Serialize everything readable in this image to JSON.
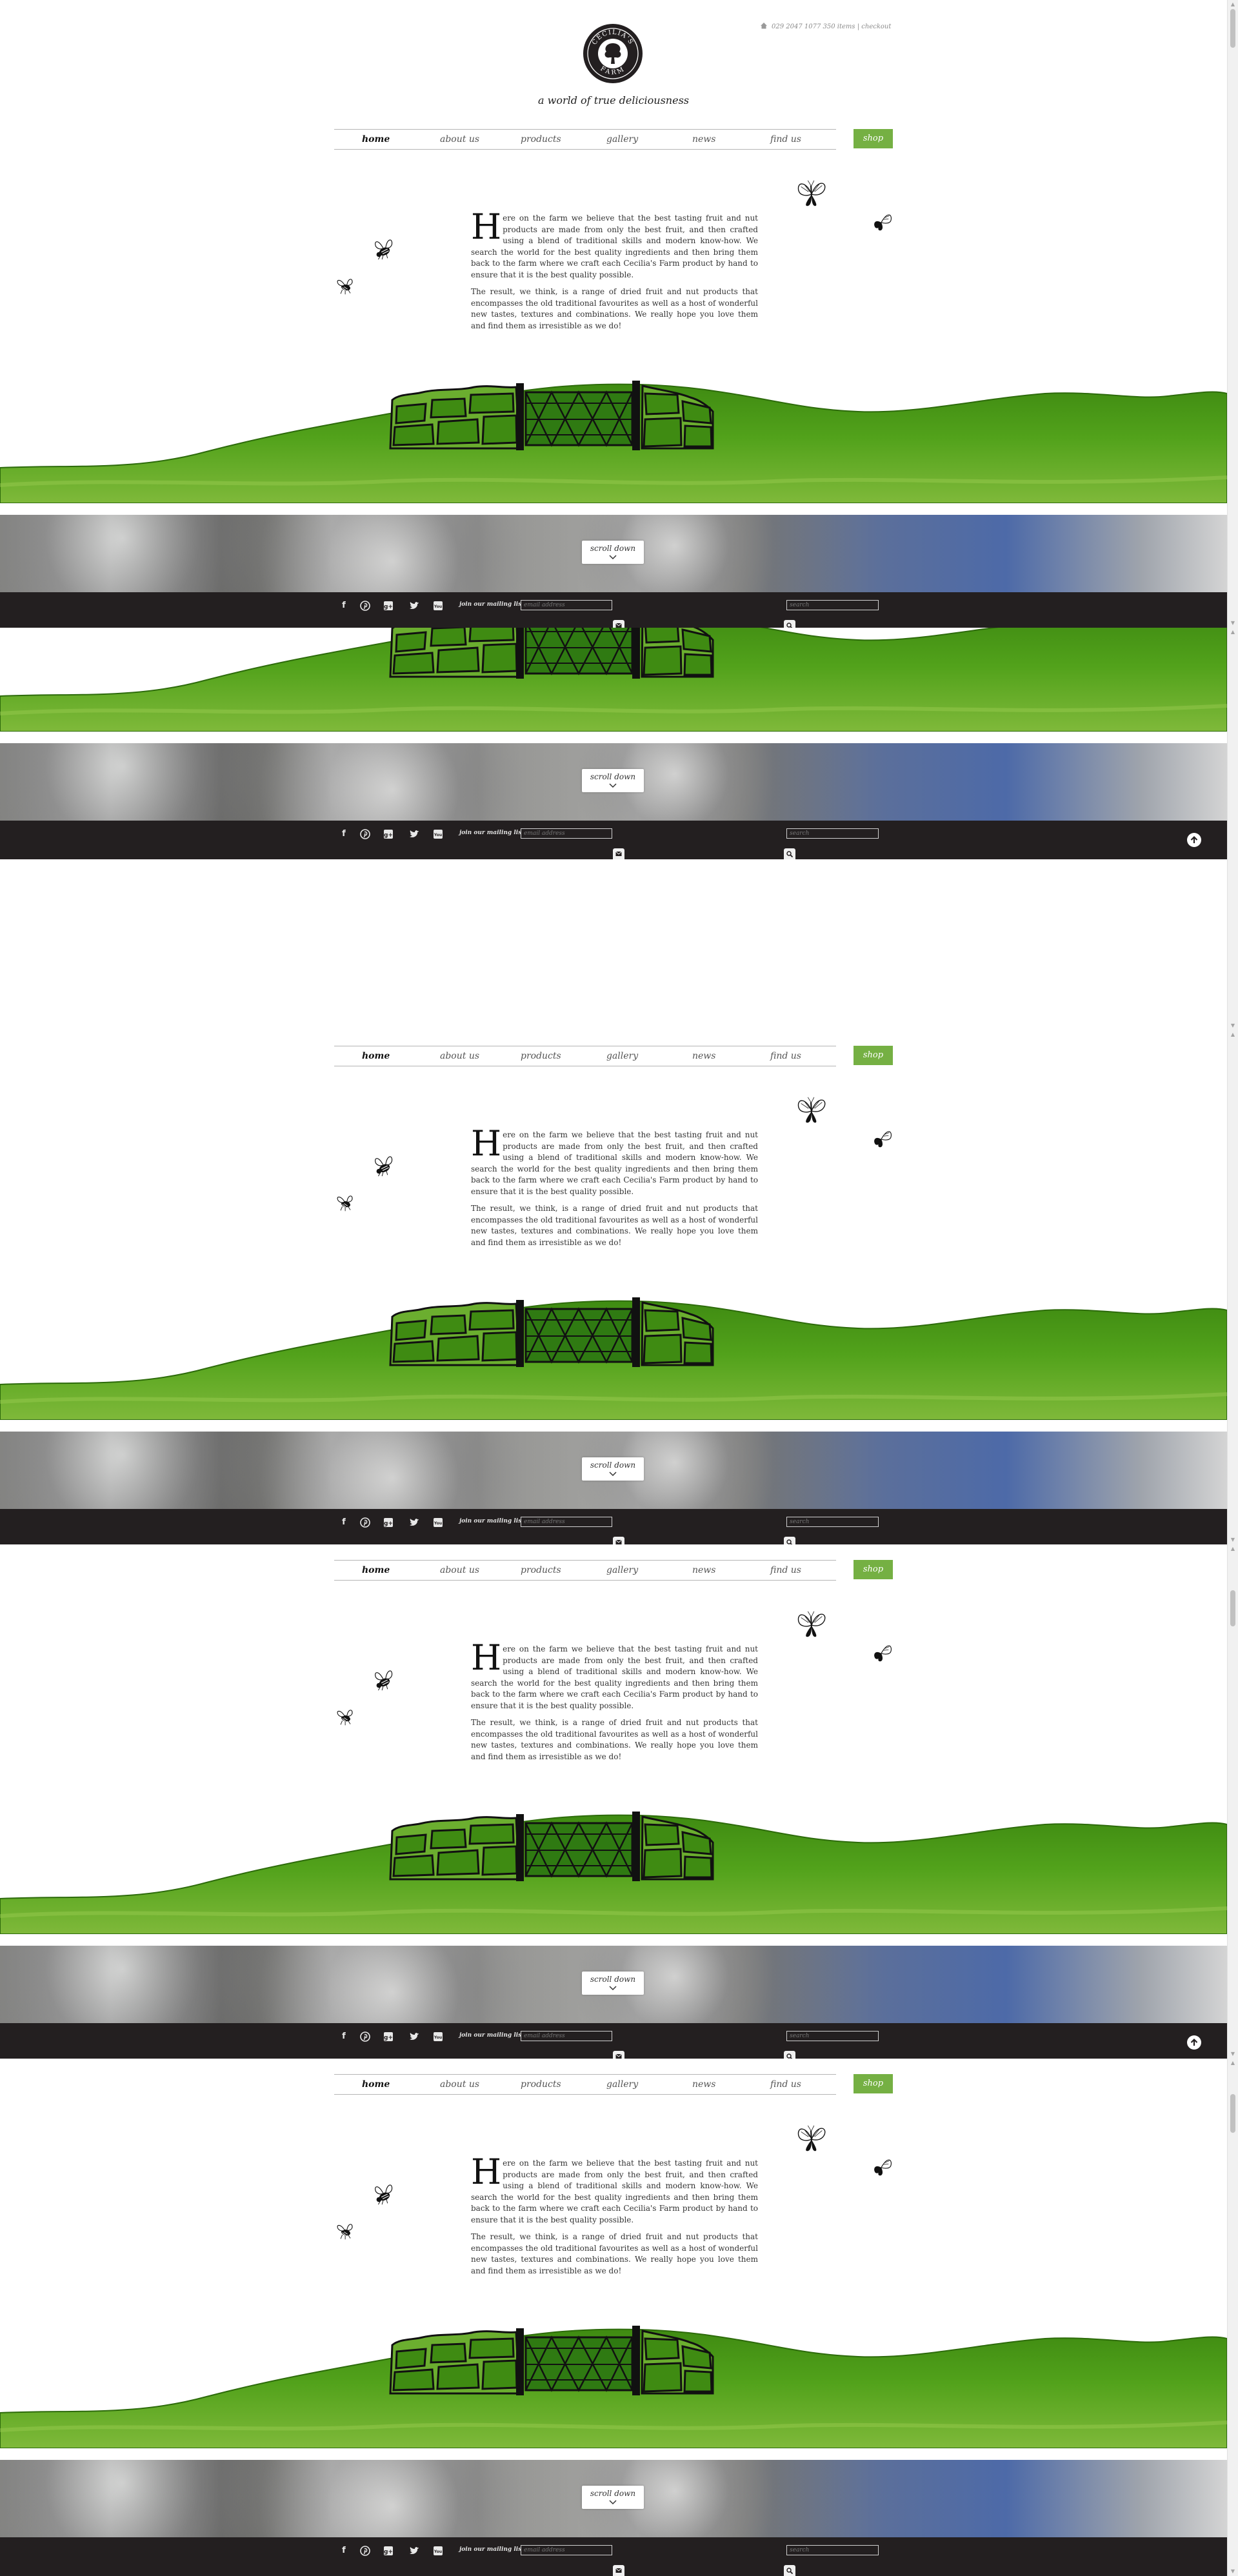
{
  "site": {
    "logo_alt": "Cecilia's Farm",
    "logo_text": "CECILIA'S FARM",
    "tagline": "a world of true deliciousness"
  },
  "header": {
    "phone": "029 2047 1077",
    "items": "350 items",
    "separator": "|",
    "checkout": "checkout"
  },
  "nav": {
    "items": [
      {
        "label": "home",
        "active": true
      },
      {
        "label": "about us"
      },
      {
        "label": "products"
      },
      {
        "label": "gallery"
      },
      {
        "label": "news"
      },
      {
        "label": "find us"
      }
    ],
    "shop_label": "shop"
  },
  "intro": {
    "dropcap": "H",
    "para1": "ere on the farm we believe that the best tasting fruit and nut products are made from only the best fruit, and then crafted using a blend of traditional skills and modern know-how. We search the world for the best quality ingredients and then bring them back to the farm where we craft each Cecilia's Farm product by hand to ensure that it is the best quality possible.",
    "para2": "The result, we think, is a range of dried fruit and nut products that encompasses the old traditional favourites as well as a host of wonderful new tastes, textures and combinations. We really hope you love them and find them as irresistible as we do!"
  },
  "scroll": {
    "label": "scroll down"
  },
  "footer": {
    "social_icons": [
      "facebook-icon",
      "pinterest-icon",
      "google-plus-icon",
      "twitter-icon",
      "youtube-icon"
    ],
    "join_label": "join our mailing list",
    "email_placeholder": "email address",
    "search_placeholder": "search"
  },
  "colors": {
    "accent_green": "#75b043",
    "footer_bg": "#231f20",
    "grass_light": "#8cc63e",
    "grass_dark": "#3f8b12"
  }
}
